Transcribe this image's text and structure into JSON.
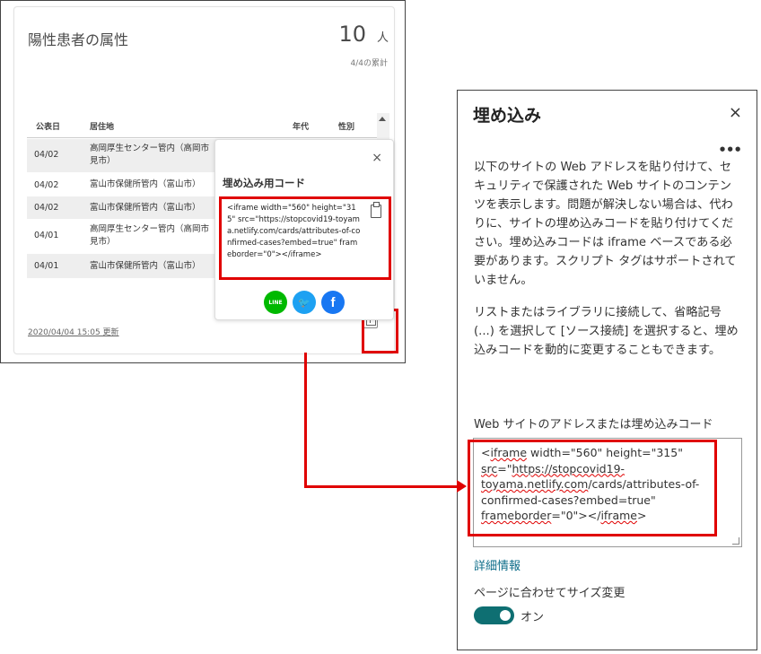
{
  "card": {
    "title": "陽性患者の属性",
    "count": "10",
    "count_unit": "人",
    "subtitle": "4/4の累計",
    "columns": [
      "公表日",
      "居住地",
      "年代",
      "性別"
    ],
    "rows": [
      {
        "date": "04/02",
        "addr": [
          "高岡厚生センター管内（高岡市",
          "見市）"
        ]
      },
      {
        "date": "04/02",
        "addr": [
          "富山市保健所管内（富山市）"
        ]
      },
      {
        "date": "04/02",
        "addr": [
          "富山市保健所管内（富山市）"
        ]
      },
      {
        "date": "04/01",
        "addr": [
          "高岡厚生センター管内（高岡市",
          "見市）"
        ]
      },
      {
        "date": "04/01",
        "addr": [
          "富山市保健所管内（富山市）"
        ]
      }
    ],
    "updated": "2020/04/04 15:05 更新"
  },
  "popup": {
    "close_icon": "×",
    "title": "埋め込み用コード",
    "code": "<iframe width=\"560\" height=\"315\" src=\"https://stopcovid19-toyama.netlify.com/cards/attributes-of-confirmed-cases?embed=true\" frameborder=\"0\"></iframe>",
    "social": {
      "line": "LINE",
      "twitter": "🐦",
      "facebook": "f"
    }
  },
  "panel": {
    "title": "埋め込み",
    "close_icon": "×",
    "more_icon": "•••",
    "para1": "以下のサイトの Web アドレスを貼り付けて、セキュリティで保護された Web サイトのコンテンツを表示します。問題が解決しない場合は、代わりに、サイトの埋め込みコードを貼り付けてください。埋め込みコードは iframe ベースである必要があります。スクリプト タグはサポートされていません。",
    "para2": "リストまたはライブラリに接続して、省略記号 (...) を選択して [ソース接続] を選択すると、埋め込みコードを動的に変更することもできます。",
    "field_label": "Web サイトのアドレスまたは埋め込みコード",
    "code": {
      "p1": "<",
      "iframe1": "iframe",
      "p2": " width=\"560\" height=\"315\" ",
      "src": "src",
      "p3": "=\"",
      "url1": "https://stopcovid19-toyama.netlify.com",
      "p4": "/cards/attributes-of-confirmed-cases?embed=true\" ",
      "fb": "frameborder",
      "p5": "=\"0\"></",
      "iframe2": "iframe",
      "p6": ">"
    },
    "link": "詳細情報",
    "toggle_label": "ページに合わせてサイズ変更",
    "toggle_state": "オン"
  },
  "colors": {
    "highlight": "#e00000",
    "toggle": "#0e6f72",
    "link": "#0f6e8a"
  }
}
